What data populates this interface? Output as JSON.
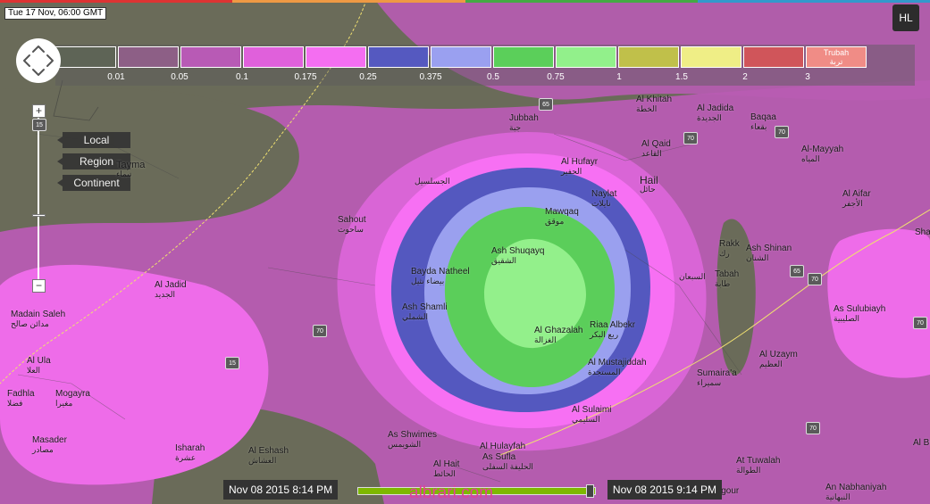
{
  "timestamp": "Tue 17 Nov, 06:00 GMT",
  "logo_text": "HL",
  "icons": {
    "pan": "pan-arrows-icon",
    "logo": "logo-icon"
  },
  "zoom": {
    "in_label": "+",
    "out_label": "−"
  },
  "scale_buttons": [
    "Local",
    "Region",
    "Continent"
  ],
  "legend": {
    "swatch_colors": [
      "#5e6456",
      "#8d5f86",
      "#b85ab5",
      "#e060db",
      "#f46ef1",
      "#5559c0",
      "#9aa0f0",
      "#5bcf5a",
      "#92f08b",
      "#c0c04a",
      "#efee86",
      "#d0555a",
      "#f08c86"
    ],
    "ticks": [
      "0.01",
      "0.05",
      "0.1",
      "0.175",
      "0.25",
      "0.375",
      "0.5",
      "0.75",
      "1",
      "1.5",
      "2",
      "3"
    ],
    "last_swatch_label": "Trubah",
    "last_swatch_label_ar": "تربة"
  },
  "places": [
    {
      "name": "Al Khitah",
      "ar": "الخطة"
    },
    {
      "name": "Al Jadida",
      "ar": "الجديدة"
    },
    {
      "name": "Jubbah",
      "ar": "جبة"
    },
    {
      "name": "Baqaa",
      "ar": "بقعاء"
    },
    {
      "name": "Al Qaid",
      "ar": "القاعد"
    },
    {
      "name": "Al-Mayyah",
      "ar": "المياه"
    },
    {
      "name": "Al Hufayr",
      "ar": "الحفير"
    },
    {
      "name": "Hail",
      "ar": "حائل"
    },
    {
      "name": "Naylat",
      "ar": "نايلات"
    },
    {
      "name": "",
      "ar": "الجسلسيل"
    },
    {
      "name": "Al Aifar",
      "ar": "الأجفر"
    },
    {
      "name": "Tayma",
      "ar": "تيماء"
    },
    {
      "name": "Mawqaq",
      "ar": "موقق"
    },
    {
      "name": "Sahout",
      "ar": "ساحوت"
    },
    {
      "name": "Ash Shuqayq",
      "ar": "الشقيق"
    },
    {
      "name": "Rakk",
      "ar": "رك"
    },
    {
      "name": "Ash Shinan",
      "ar": "الشنان"
    },
    {
      "name": "",
      "ar": "السبعان"
    },
    {
      "name": "Tabah",
      "ar": "طابة"
    },
    {
      "name": "Bayda Natheel",
      "ar": "بيضاء نثيل"
    },
    {
      "name": "Al Jadid",
      "ar": "الجديد"
    },
    {
      "name": "Ash Shamli",
      "ar": "الشملي"
    },
    {
      "name": "Riaa Albekr",
      "ar": "ربع البكر"
    },
    {
      "name": "As Sulubiayh",
      "ar": "الصليبية"
    },
    {
      "name": "Madain Saleh",
      "ar": "مدائن صالح"
    },
    {
      "name": "Al Ghazalah",
      "ar": "الغزالة"
    },
    {
      "name": "Al Uzaym",
      "ar": "العظيم"
    },
    {
      "name": "Al Ula",
      "ar": "العلا"
    },
    {
      "name": "Al Mustajiddah",
      "ar": "المستجدة"
    },
    {
      "name": "Sumaira'a",
      "ar": "سميراء"
    },
    {
      "name": "Fadhla",
      "ar": "فضلا"
    },
    {
      "name": "Mogayra",
      "ar": "مغيرا"
    },
    {
      "name": "Al Sulaimi",
      "ar": "السليمي"
    },
    {
      "name": "Masader",
      "ar": "مصادر"
    },
    {
      "name": "As Shwimes",
      "ar": "الشويمس"
    },
    {
      "name": "Isharah",
      "ar": "عشرة"
    },
    {
      "name": "Al Eshash",
      "ar": "العشاش"
    },
    {
      "name": "Al Hulayfah",
      "ar": ""
    },
    {
      "name": "As Sufla",
      "ar": "الحليفة السفلى"
    },
    {
      "name": "Al Hait",
      "ar": "الحائط"
    },
    {
      "name": "At Tuwalah",
      "ar": "الطوالة"
    },
    {
      "name": "Al Buk",
      "ar": ""
    },
    {
      "name": "An Nabhaniyah",
      "ar": "النبهانية"
    },
    {
      "name": "Asugour",
      "ar": ""
    },
    {
      "name": "Sha",
      "ar": ""
    }
  ],
  "road_shields": [
    "65",
    "70",
    "70",
    "65",
    "70",
    "70",
    "70",
    "15",
    "15",
    "70"
  ],
  "timebar": {
    "start": "Nov 08 2015 8:14 PM",
    "end": "Nov 08 2015 9:14 PM",
    "progress": 1.0
  },
  "watermark": "albrari.com"
}
